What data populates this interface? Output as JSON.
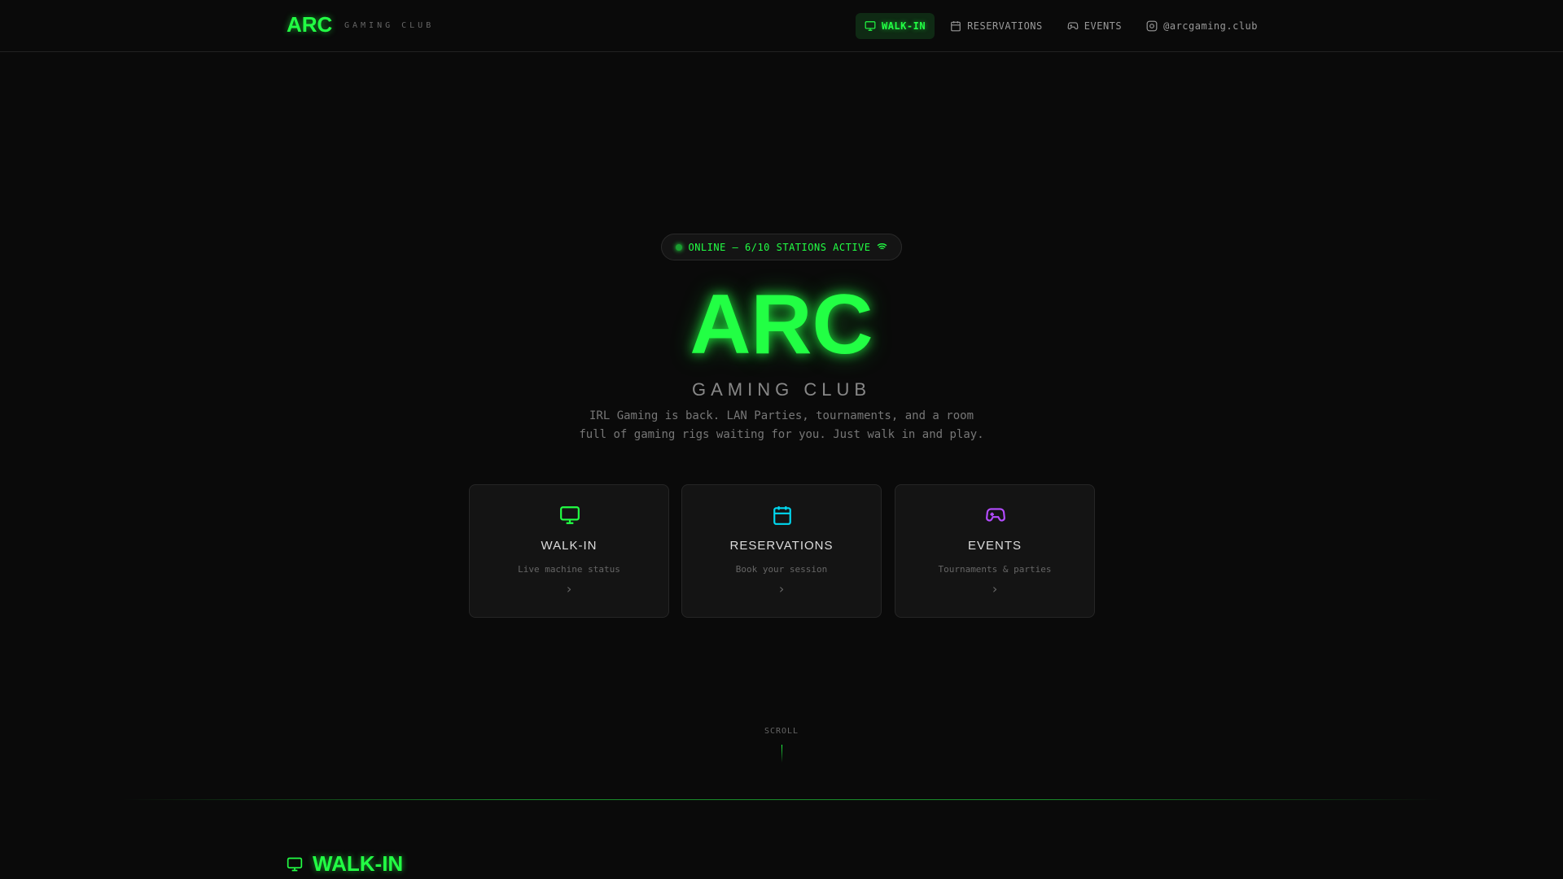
{
  "header": {
    "logo": "ARC",
    "logo_sub": "GAMING CLUB",
    "nav": [
      {
        "label": "WALK-IN",
        "icon": "monitor-icon"
      },
      {
        "label": "RESERVATIONS",
        "icon": "calendar-icon"
      },
      {
        "label": "EVENTS",
        "icon": "gamepad-icon"
      },
      {
        "label": "@arcgaming.club",
        "icon": "instagram-icon"
      }
    ]
  },
  "hero": {
    "status": "ONLINE — 6/10 STATIONS ACTIVE",
    "title": "ARC",
    "subtitle": "GAMING CLUB",
    "desc_line1": "IRL Gaming is back. LAN Parties, tournaments, and a room",
    "desc_line2": "full of gaming rigs waiting for you. Just walk in and play."
  },
  "cards": [
    {
      "title": "WALK-IN",
      "sub": "Live machine status",
      "chevron": "›",
      "color": "#22ff44"
    },
    {
      "title": "RESERVATIONS",
      "sub": "Book your session",
      "chevron": "›",
      "color": "#00d8f0"
    },
    {
      "title": "EVENTS",
      "sub": "Tournaments & parties",
      "chevron": "›",
      "color": "#b44cff"
    }
  ],
  "scroll": "SCROLL",
  "section": {
    "title": "WALK-IN"
  }
}
